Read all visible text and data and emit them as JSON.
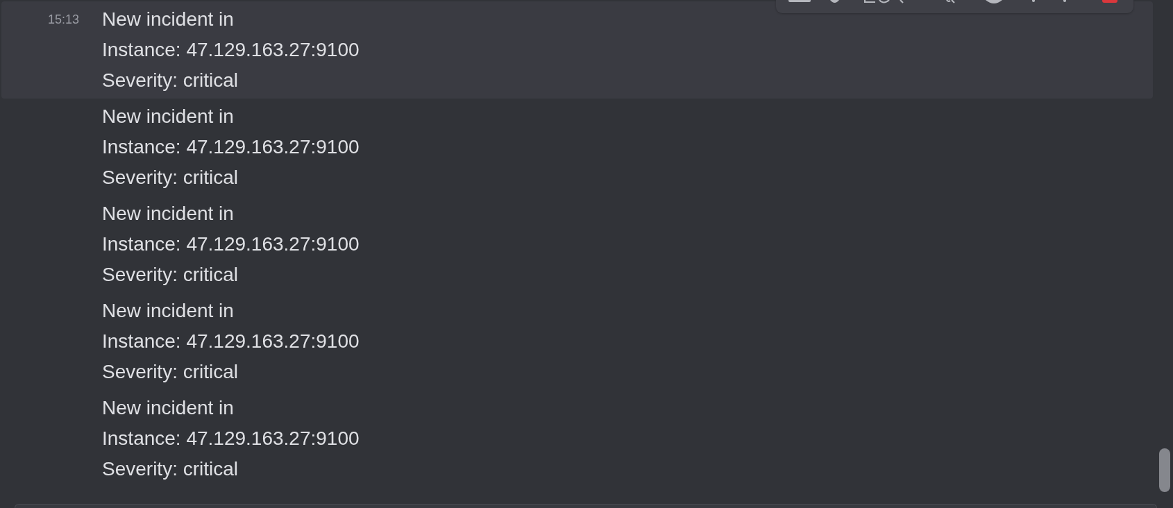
{
  "messages": [
    {
      "time": "15:13",
      "hovered": true,
      "lines": [
        "New incident in",
        "Instance: 47.129.163.27:9100",
        "Severity: critical"
      ]
    },
    {
      "hovered": false,
      "lines": [
        "New incident in",
        "Instance: 47.129.163.27:9100",
        "Severity: critical"
      ]
    },
    {
      "hovered": false,
      "lines": [
        "New incident in",
        "Instance: 47.129.163.27:9100",
        "Severity: critical"
      ]
    },
    {
      "hovered": false,
      "lines": [
        "New incident in",
        "Instance: 47.129.163.27:9100",
        "Severity: critical"
      ]
    },
    {
      "hovered": false,
      "lines": [
        "New incident in",
        "Instance: 47.129.163.27:9100",
        "Severity: critical"
      ]
    }
  ]
}
